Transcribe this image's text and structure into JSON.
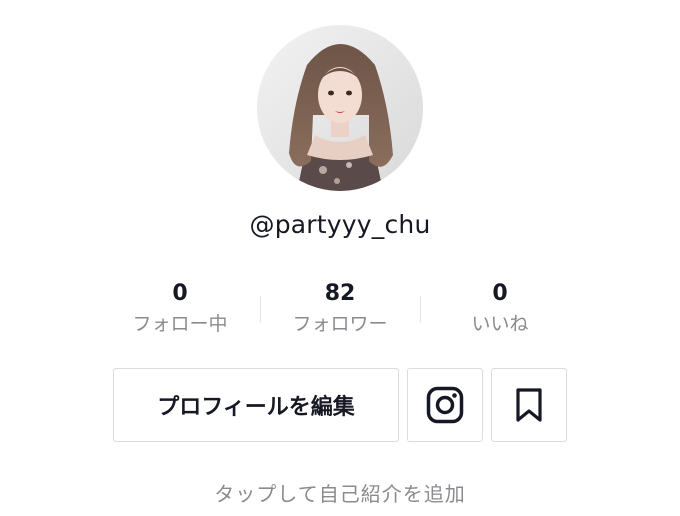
{
  "profile": {
    "username": "@partyyy_chu",
    "bio_placeholder": "タップして自己紹介を追加"
  },
  "stats": [
    {
      "count": "0",
      "label": "フォロー中"
    },
    {
      "count": "82",
      "label": "フォロワー"
    },
    {
      "count": "0",
      "label": "いいね"
    }
  ],
  "actions": {
    "edit_profile_label": "プロフィールを編集",
    "instagram_icon": "instagram-icon",
    "bookmark_icon": "bookmark-icon"
  },
  "colors": {
    "primary_text": "#161823",
    "secondary_text": "#8a8b91",
    "border": "#dcdcde"
  }
}
